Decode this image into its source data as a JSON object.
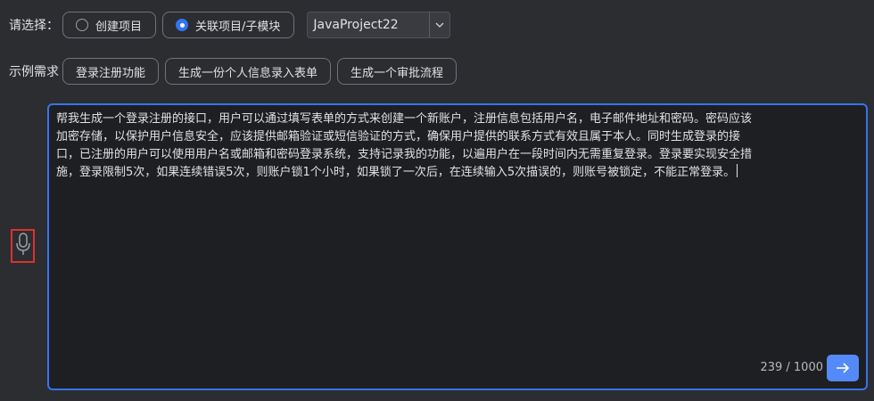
{
  "mode_row": {
    "label": "请选择：",
    "options": [
      {
        "label": "创建项目",
        "checked": false
      },
      {
        "label": "关联项目/子模块",
        "checked": true
      }
    ],
    "project_select": {
      "value": "JavaProject22"
    }
  },
  "examples_row": {
    "label": "示例需求",
    "items": [
      "登录注册功能",
      "生成一份个人信息录入表单",
      "生成一个审批流程"
    ]
  },
  "editor": {
    "text": "帮我生成一个登录注册的接口，用户可以通过填写表单的方式来创建一个新账户，注册信息包括用户名，电子邮件地址和密码。密码应该加密存储，以保护用户信息安全，应该提供邮箱验证或短信验证的方式，确保用户提供的联系方式有效且属于本人。同时生成登录的接口，已注册的用户可以使用用户名或邮箱和密码登录系统，支持记录我的功能，以遍用户在一段时间内无需重复登录。登录要实现安全措施，登录限制5次，如果连续错误5次，则账户锁1个小时，如果锁了一次后，在连续输入5次描误的，则账号被锁定，不能正常登录。",
    "counter": "239 / 1000"
  },
  "icons": {
    "mic": "microphone-icon",
    "send": "arrow-right-icon",
    "dropdown": "chevron-down-icon"
  },
  "colors": {
    "accent": "#3574f0",
    "send_button": "#548af7",
    "highlight_border": "#e0302e",
    "background": "#2b2d31",
    "editor_background": "#1e1f22"
  }
}
